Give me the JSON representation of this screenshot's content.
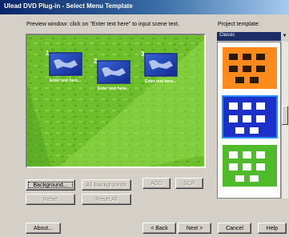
{
  "window": {
    "title": "Ulead DVD Plug-in - Select Menu Template"
  },
  "preview": {
    "instructions": "Preview window:  click on \"Enter text here\" to input scene text.",
    "scenes": [
      {
        "number": "1",
        "label": "Enter text here..."
      },
      {
        "number": "2",
        "label": "Enter text here..."
      },
      {
        "number": "3",
        "label": "Enter text here..."
      }
    ]
  },
  "templates": {
    "label": "Project template:",
    "selected": "Classic"
  },
  "buttons": {
    "background": "Background...",
    "all_backgrounds": "All Backgrounds",
    "reset": "Reset",
    "reset_all": "Reset All",
    "add": "ADD",
    "scroll": "SCR",
    "about": "About...",
    "back": "< Back",
    "next": "Next >",
    "cancel": "Cancel",
    "help": "Help"
  },
  "colors": {
    "title_bar": "#0a246a",
    "preview_bg": "#6fbf2d",
    "template_orange": "#ff8a1c",
    "template_blue": "#1a30c8",
    "template_green": "#4fbb2b"
  }
}
